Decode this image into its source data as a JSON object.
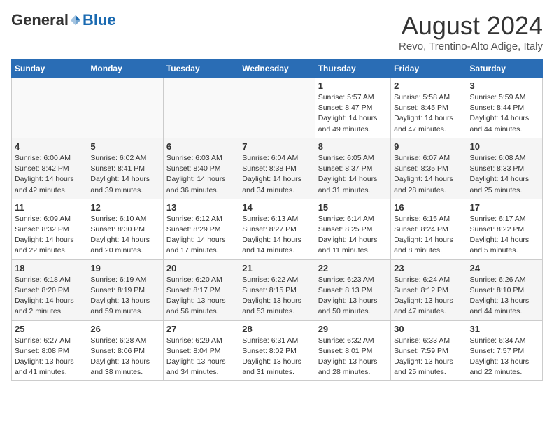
{
  "header": {
    "logo_general": "General",
    "logo_blue": "Blue",
    "title": "August 2024",
    "subtitle": "Revo, Trentino-Alto Adige, Italy"
  },
  "days_of_week": [
    "Sunday",
    "Monday",
    "Tuesday",
    "Wednesday",
    "Thursday",
    "Friday",
    "Saturday"
  ],
  "weeks": [
    [
      {
        "day": "",
        "info": ""
      },
      {
        "day": "",
        "info": ""
      },
      {
        "day": "",
        "info": ""
      },
      {
        "day": "",
        "info": ""
      },
      {
        "day": "1",
        "info": "Sunrise: 5:57 AM\nSunset: 8:47 PM\nDaylight: 14 hours and 49 minutes."
      },
      {
        "day": "2",
        "info": "Sunrise: 5:58 AM\nSunset: 8:45 PM\nDaylight: 14 hours and 47 minutes."
      },
      {
        "day": "3",
        "info": "Sunrise: 5:59 AM\nSunset: 8:44 PM\nDaylight: 14 hours and 44 minutes."
      }
    ],
    [
      {
        "day": "4",
        "info": "Sunrise: 6:00 AM\nSunset: 8:42 PM\nDaylight: 14 hours and 42 minutes."
      },
      {
        "day": "5",
        "info": "Sunrise: 6:02 AM\nSunset: 8:41 PM\nDaylight: 14 hours and 39 minutes."
      },
      {
        "day": "6",
        "info": "Sunrise: 6:03 AM\nSunset: 8:40 PM\nDaylight: 14 hours and 36 minutes."
      },
      {
        "day": "7",
        "info": "Sunrise: 6:04 AM\nSunset: 8:38 PM\nDaylight: 14 hours and 34 minutes."
      },
      {
        "day": "8",
        "info": "Sunrise: 6:05 AM\nSunset: 8:37 PM\nDaylight: 14 hours and 31 minutes."
      },
      {
        "day": "9",
        "info": "Sunrise: 6:07 AM\nSunset: 8:35 PM\nDaylight: 14 hours and 28 minutes."
      },
      {
        "day": "10",
        "info": "Sunrise: 6:08 AM\nSunset: 8:33 PM\nDaylight: 14 hours and 25 minutes."
      }
    ],
    [
      {
        "day": "11",
        "info": "Sunrise: 6:09 AM\nSunset: 8:32 PM\nDaylight: 14 hours and 22 minutes."
      },
      {
        "day": "12",
        "info": "Sunrise: 6:10 AM\nSunset: 8:30 PM\nDaylight: 14 hours and 20 minutes."
      },
      {
        "day": "13",
        "info": "Sunrise: 6:12 AM\nSunset: 8:29 PM\nDaylight: 14 hours and 17 minutes."
      },
      {
        "day": "14",
        "info": "Sunrise: 6:13 AM\nSunset: 8:27 PM\nDaylight: 14 hours and 14 minutes."
      },
      {
        "day": "15",
        "info": "Sunrise: 6:14 AM\nSunset: 8:25 PM\nDaylight: 14 hours and 11 minutes."
      },
      {
        "day": "16",
        "info": "Sunrise: 6:15 AM\nSunset: 8:24 PM\nDaylight: 14 hours and 8 minutes."
      },
      {
        "day": "17",
        "info": "Sunrise: 6:17 AM\nSunset: 8:22 PM\nDaylight: 14 hours and 5 minutes."
      }
    ],
    [
      {
        "day": "18",
        "info": "Sunrise: 6:18 AM\nSunset: 8:20 PM\nDaylight: 14 hours and 2 minutes."
      },
      {
        "day": "19",
        "info": "Sunrise: 6:19 AM\nSunset: 8:19 PM\nDaylight: 13 hours and 59 minutes."
      },
      {
        "day": "20",
        "info": "Sunrise: 6:20 AM\nSunset: 8:17 PM\nDaylight: 13 hours and 56 minutes."
      },
      {
        "day": "21",
        "info": "Sunrise: 6:22 AM\nSunset: 8:15 PM\nDaylight: 13 hours and 53 minutes."
      },
      {
        "day": "22",
        "info": "Sunrise: 6:23 AM\nSunset: 8:13 PM\nDaylight: 13 hours and 50 minutes."
      },
      {
        "day": "23",
        "info": "Sunrise: 6:24 AM\nSunset: 8:12 PM\nDaylight: 13 hours and 47 minutes."
      },
      {
        "day": "24",
        "info": "Sunrise: 6:26 AM\nSunset: 8:10 PM\nDaylight: 13 hours and 44 minutes."
      }
    ],
    [
      {
        "day": "25",
        "info": "Sunrise: 6:27 AM\nSunset: 8:08 PM\nDaylight: 13 hours and 41 minutes."
      },
      {
        "day": "26",
        "info": "Sunrise: 6:28 AM\nSunset: 8:06 PM\nDaylight: 13 hours and 38 minutes."
      },
      {
        "day": "27",
        "info": "Sunrise: 6:29 AM\nSunset: 8:04 PM\nDaylight: 13 hours and 34 minutes."
      },
      {
        "day": "28",
        "info": "Sunrise: 6:31 AM\nSunset: 8:02 PM\nDaylight: 13 hours and 31 minutes."
      },
      {
        "day": "29",
        "info": "Sunrise: 6:32 AM\nSunset: 8:01 PM\nDaylight: 13 hours and 28 minutes."
      },
      {
        "day": "30",
        "info": "Sunrise: 6:33 AM\nSunset: 7:59 PM\nDaylight: 13 hours and 25 minutes."
      },
      {
        "day": "31",
        "info": "Sunrise: 6:34 AM\nSunset: 7:57 PM\nDaylight: 13 hours and 22 minutes."
      }
    ]
  ]
}
